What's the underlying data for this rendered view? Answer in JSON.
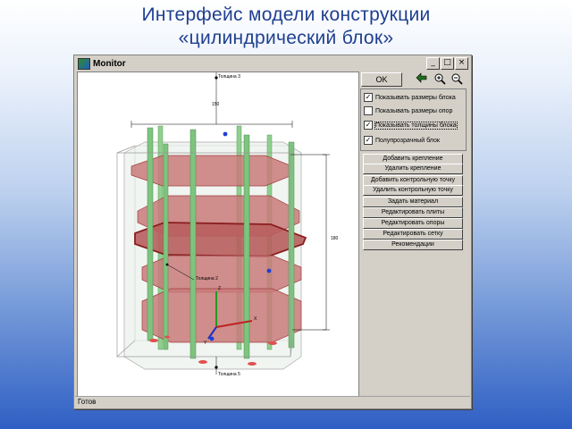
{
  "slide": {
    "title_line1": "Интерфейс  модели конструкции",
    "title_line2": "«цилиндрический блок»"
  },
  "window": {
    "title": "Monitor",
    "controls": {
      "minimize": "_",
      "maximize": "□",
      "close": "×"
    }
  },
  "viewport": {
    "labels": {
      "top_thickness": "Толщина 3",
      "mid_thickness": "Толщина 2",
      "bottom_thickness": "Толщина 5",
      "width_dimension": "150",
      "height_dimension": "180",
      "axis_z": "Z",
      "axis_y": "Y",
      "axis_x": "X"
    }
  },
  "panel": {
    "ok_label": "OK",
    "tool_icons": [
      "arrow-icon",
      "zoom-in-icon",
      "zoom-out-icon"
    ],
    "checkboxes": [
      {
        "label": "Показывать размеры блока",
        "checked": true,
        "mark": "✓"
      },
      {
        "label": "Показывать размеры опор",
        "checked": false,
        "mark": ""
      },
      {
        "label": "Показывать толщины блока",
        "checked": true,
        "mark": "✓"
      },
      {
        "label": "Полупрозрачный блок",
        "checked": true,
        "mark": "✓"
      }
    ],
    "buttons": [
      "Добавить крепление",
      "Удалить крепление",
      "Добавить контрольную точку",
      "Удалить контрольную точку",
      "Задать материал",
      "Редактировать плиты",
      "Редактировать опоры",
      "Редактировать сетку",
      "Рекомендации"
    ]
  },
  "status": {
    "text": "Готов"
  },
  "colors": {
    "slab": "#c97a7a",
    "slab_edge": "#9b2a2a",
    "column": "#7ec47e",
    "box_edge": "#9a9a9a",
    "point": "#1f3fd6"
  }
}
